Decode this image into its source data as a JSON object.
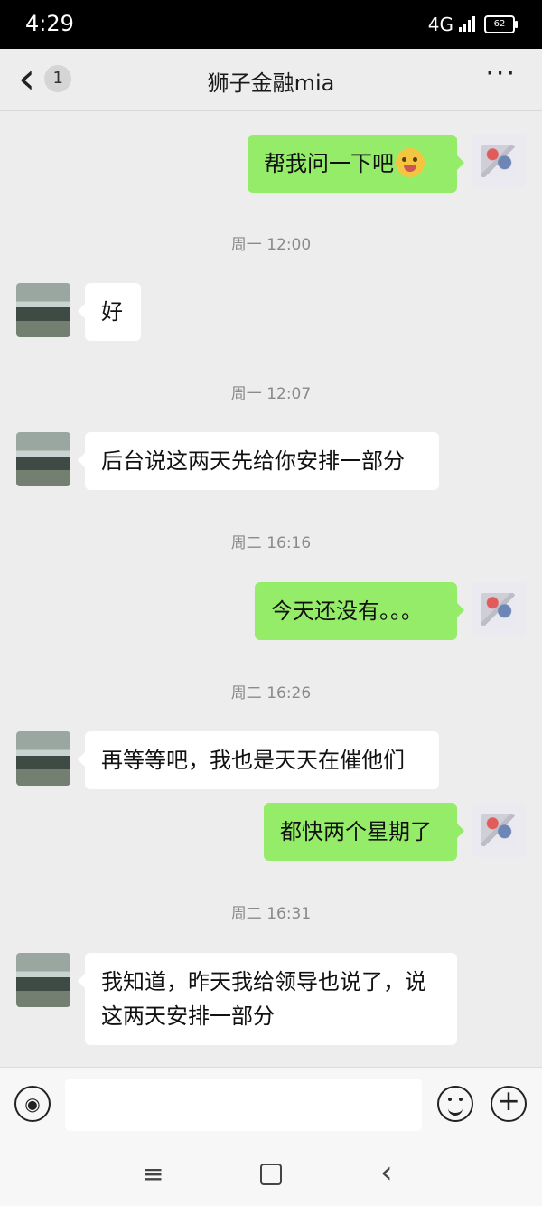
{
  "status": {
    "time": "4:29",
    "network": "4G",
    "battery": "62"
  },
  "header": {
    "back_badge": "1",
    "title": "狮子金融mia",
    "more": "···"
  },
  "messages": [
    {
      "side": "out",
      "text": "帮我问一下吧"
    },
    {
      "side": "time",
      "text": "周一 12:00"
    },
    {
      "side": "in",
      "text": "好"
    },
    {
      "side": "time",
      "text": "周一 12:07"
    },
    {
      "side": "in",
      "text": "后台说这两天先给你安排一部分"
    },
    {
      "side": "time",
      "text": "周二 16:16"
    },
    {
      "side": "out",
      "text": "今天还没有。。。"
    },
    {
      "side": "time",
      "text": "周二 16:26"
    },
    {
      "side": "in",
      "text": "再等等吧，我也是天天在催他们"
    },
    {
      "side": "out",
      "text": "都快两个星期了"
    },
    {
      "side": "time",
      "text": "周二 16:31"
    },
    {
      "side": "in",
      "text": "我知道，昨天我给领导也说了，说这两天安排一部分"
    }
  ],
  "icons": {
    "back": "‹",
    "voice": "◉",
    "emoji": "emoji-icon",
    "plus": "+",
    "menu": "≡",
    "back_nav": "‹"
  }
}
